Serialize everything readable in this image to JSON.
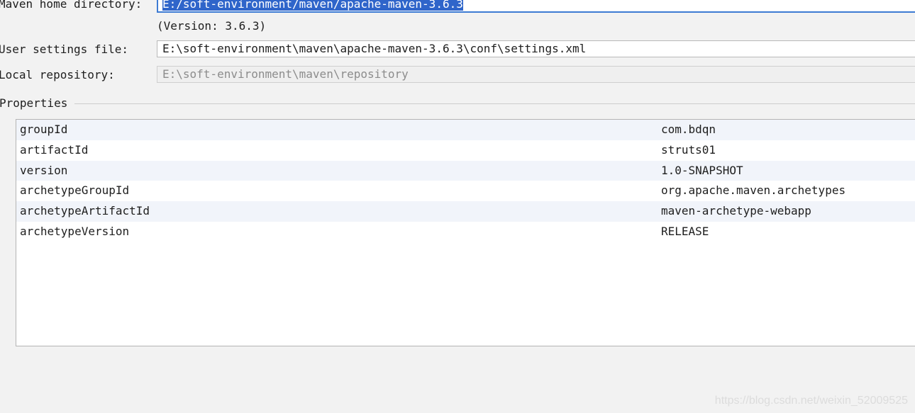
{
  "maven_home": {
    "label": "Maven home directory:",
    "value": "E:/soft-environment/maven/apache-maven-3.6.3",
    "version_text": "(Version: 3.6.3)"
  },
  "user_settings": {
    "label": "User settings file:",
    "value": "E:\\soft-environment\\maven\\apache-maven-3.6.3\\conf\\settings.xml"
  },
  "local_repository": {
    "label": "Local repository:",
    "value": "E:\\soft-environment\\maven\\repository"
  },
  "properties": {
    "title": "Properties",
    "rows": [
      {
        "key": "groupId",
        "value": "com.bdqn"
      },
      {
        "key": "artifactId",
        "value": "struts01"
      },
      {
        "key": "version",
        "value": "1.0-SNAPSHOT"
      },
      {
        "key": "archetypeGroupId",
        "value": "org.apache.maven.archetypes"
      },
      {
        "key": "archetypeArtifactId",
        "value": "maven-archetype-webapp"
      },
      {
        "key": "archetypeVersion",
        "value": "RELEASE"
      }
    ]
  },
  "watermark": "https://blog.csdn.net/weixin_52009525",
  "colors": {
    "selection": "#2f65ca",
    "focus_border": "#3d7bd3",
    "alt_row": "#f1f4fa"
  }
}
